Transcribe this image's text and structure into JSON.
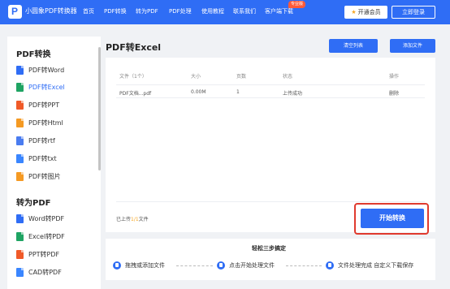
{
  "header": {
    "logo_letter": "P",
    "brand": "小圆象PDF转换器",
    "nav": [
      "首页",
      "PDF转换",
      "转为PDF",
      "PDF处理",
      "使用教程",
      "联系我们",
      "客户端下载"
    ],
    "badge": "专业版",
    "vip_label": "开通会员",
    "login_label": "立即登录"
  },
  "sidebar": {
    "group1_title": "PDF转换",
    "group1_items": [
      {
        "label": "PDF转Word",
        "icon": "word-file-icon",
        "color": "#2f6df5"
      },
      {
        "label": "PDF转Excel",
        "icon": "excel-file-icon",
        "color": "#1fa463"
      },
      {
        "label": "PDF转PPT",
        "icon": "ppt-file-icon",
        "color": "#f05a28"
      },
      {
        "label": "PDF转Html",
        "icon": "html-file-icon",
        "color": "#f59a23"
      },
      {
        "label": "PDF转rtf",
        "icon": "rtf-file-icon",
        "color": "#4a7cf0"
      },
      {
        "label": "PDF转txt",
        "icon": "txt-file-icon",
        "color": "#3a86ff"
      },
      {
        "label": "PDF转图片",
        "icon": "image-file-icon",
        "color": "#f59a23"
      }
    ],
    "active_index": 1,
    "group2_title": "转为PDF",
    "group2_items": [
      {
        "label": "Word转PDF",
        "icon": "word-file-icon",
        "color": "#2f6df5"
      },
      {
        "label": "Excel转PDF",
        "icon": "excel-file-icon",
        "color": "#1fa463"
      },
      {
        "label": "PPT转PDF",
        "icon": "ppt-file-icon",
        "color": "#f05a28"
      },
      {
        "label": "CAD转PDF",
        "icon": "cad-file-icon",
        "color": "#3a86ff"
      }
    ]
  },
  "main": {
    "title": "PDF转Excel",
    "clear_label": "清空列表",
    "add_label": "添加文件",
    "columns": [
      "文件（1个）",
      "大小",
      "页数",
      "状态",
      "操作"
    ],
    "rows": [
      {
        "name": "PDF文档...pdf",
        "size": "0.00M",
        "pages": "1",
        "status": "上传成功",
        "action": "删除"
      }
    ],
    "uploaded_prefix": "已上传",
    "uploaded_count": "1/1",
    "uploaded_suffix": "文件",
    "start_label": "开始转换"
  },
  "steps": {
    "title": "轻松三步搞定",
    "items": [
      "拖拽或添加文件",
      "点击开始处理文件",
      "文件处理完成 自定义下载保存"
    ]
  },
  "colors": {
    "primary": "#2f6df5",
    "highlight": "#e03a2e",
    "accent": "#f5a623"
  }
}
